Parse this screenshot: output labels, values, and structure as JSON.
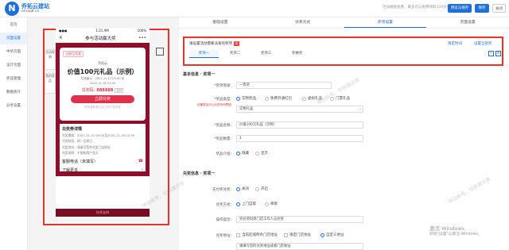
{
  "header": {
    "logo_letter": "N",
    "brand_name": "乔拓云建站",
    "brand_url": "omaq8.cn",
    "hint": "活动模板免费，最多可以免费领取100份奖品",
    "preview_label": "预览与保存",
    "save_label": "保存",
    "close_label": "关闭"
  },
  "sidebar": {
    "items": [
      {
        "label": "首页"
      },
      {
        "label": "页面设置"
      },
      {
        "label": "中奖页面"
      },
      {
        "label": "设计页面"
      },
      {
        "label": "奖品管理"
      },
      {
        "label": "数据统计"
      },
      {
        "label": "分享设置"
      }
    ]
  },
  "phone": {
    "time": "1:21 AM",
    "battery": "100%",
    "title": "参与活动赢大奖",
    "card": {
      "tag": "立即可兑奖",
      "brand": "乔拓云",
      "title": "价值100元礼品（示例）",
      "line1": "兑奖截止：2022.11.11 00:00 至",
      "line2": "2022.11.18 23:59",
      "code_label": "兑奖码:",
      "code": "888888",
      "copy": "复制",
      "redeem": "立即兑奖",
      "foot": "凭兑奖码到门店工作人员兑奖"
    },
    "detail": {
      "heading": "兑奖券详情",
      "line1": "兑奖期限：2022-11-11 00:00至2022-11-18 23:59",
      "line2": "可用时段：周一至周日",
      "line3": "兑奖地址：请填写您的兑奖门店地址",
      "line4": "兑奖说明：不限制用户显示",
      "phone_label": "客服电话（未填写）",
      "more_label": "了解更多"
    },
    "footer": "技术支持"
  },
  "side_tabs": {
    "rules": "活动规则",
    "prizes": "我的奖品"
  },
  "main_tabs": [
    {
      "label": "基础设置"
    },
    {
      "label": "派奖方式"
    },
    {
      "label": "奖项设置"
    },
    {
      "label": "页面设置"
    }
  ],
  "prize_box": {
    "title": "请设置活动需要派发的奖项",
    "badge": "图",
    "limit_label": "限定时间",
    "setall_label": "设置全部奖",
    "tabs": [
      "奖项一",
      "奖项二",
      "奖项三",
      "参赛奖"
    ]
  },
  "form": {
    "basic_section": "基本信息 · 奖项一",
    "name_label": "奖项等级:",
    "name_value": "一等奖",
    "type_label": "奖品类型:",
    "type_hint": "设置奖品可以派发有所限制",
    "type_options": [
      "实物奖品",
      "免费开通红包",
      "虚拟礼品",
      "门票礼品"
    ],
    "type_select": "实物礼品",
    "prize_name_label": "奖品名称:",
    "prize_name_value": "价值100元礼品（示例）",
    "qty_label": "奖品数量:",
    "qty_value": "1",
    "show_label": "奖品介绍:",
    "show_options": [
      "隐藏",
      "显示"
    ],
    "redeem_section": "兑奖信息 · 奖项一",
    "code_label": "支付奖兑奖:",
    "code_options": [
      "关闭",
      "开启"
    ],
    "method_label": "兑奖方式:",
    "method_options": [
      "上门自取",
      "邮寄"
    ],
    "op_label": "操作提示:",
    "op_value": "凭兑奖码到门店工作人员兑奖",
    "addr_label": "兑奖地址:",
    "addr_options": [
      "当前区域所有门店地址",
      "限定门店地址",
      "自定义地址"
    ],
    "addr_value": "请填写您的兑奖地址或者门店地址"
  },
  "watermark": "体验帐号，仅供演示用",
  "windows": {
    "line1": "激活 Windows",
    "line2": "转到\"设置\"以激活 Windows。"
  },
  "colors": {
    "brand": "#1f6fd8",
    "accent": "#e0314a",
    "hero": "#8e0f2b",
    "highlight_box": "#e5332a"
  }
}
